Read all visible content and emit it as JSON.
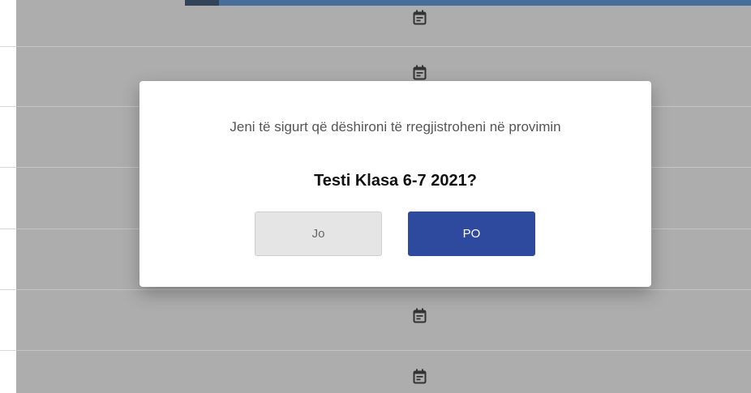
{
  "dialog": {
    "message": "Jeni të sigurt që dëshironi të rregjistroheni në provimin",
    "exam_name": "Testi Klasa 6-7 2021?",
    "no_label": "Jo",
    "yes_label": "PO"
  },
  "colors": {
    "primary_button": "#2e4a9e",
    "secondary_button": "#e5e5e5",
    "overlay": "#adadad",
    "header_bar": "#476f9a"
  },
  "icons": {
    "row_icon": "calendar-icon"
  }
}
